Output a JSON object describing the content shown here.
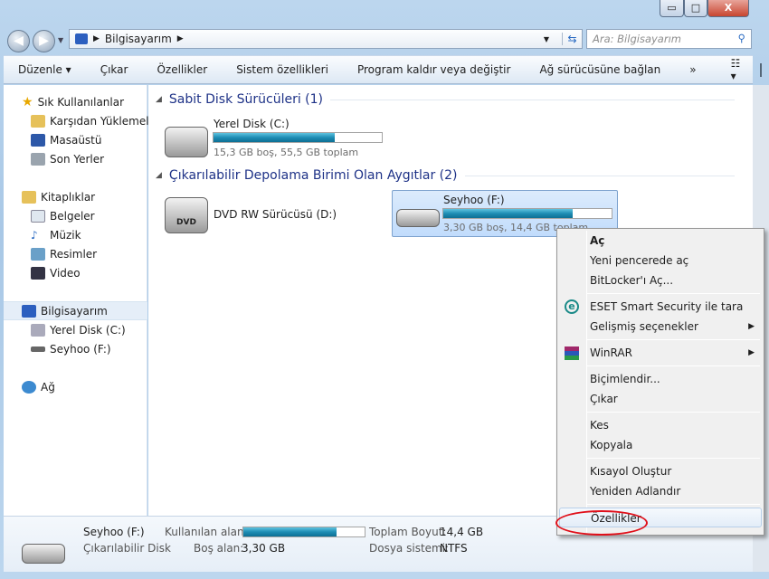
{
  "window": {
    "minimize": "▭",
    "maximize": "□",
    "close": "X"
  },
  "address": {
    "crumb": "Bilgisayarım",
    "search_placeholder": "Ara: Bilgisayarım"
  },
  "toolbar": {
    "items": [
      "Düzenle",
      "Çıkar",
      "Özellikler",
      "Sistem özellikleri",
      "Program kaldır veya değiştir",
      "Ağ sürücüsüne bağlan"
    ],
    "more": "»"
  },
  "sidebar": {
    "favorites": {
      "label": "Sık Kullanılanlar",
      "items": [
        "Karşıdan Yüklemeler",
        "Masaüstü",
        "Son Yerler"
      ]
    },
    "libraries": {
      "label": "Kitaplıklar",
      "items": [
        "Belgeler",
        "Müzik",
        "Resimler",
        "Video"
      ]
    },
    "computer": {
      "label": "Bilgisayarım",
      "items": [
        "Yerel Disk (C:)",
        "Seyhoo (F:)"
      ]
    },
    "network": {
      "label": "Ağ"
    }
  },
  "groups": [
    {
      "title": "Sabit Disk Sürücüleri (1)"
    },
    {
      "title": "Çıkarılabilir Depolama Birimi Olan Aygıtlar (2)"
    }
  ],
  "drives": {
    "c": {
      "name": "Yerel Disk (C:)",
      "info": "15,3 GB boş, 55,5 GB toplam",
      "used_fraction": 0.72
    },
    "d": {
      "name": "DVD RW Sürücüsü (D:)",
      "badge": "DVD"
    },
    "f": {
      "name": "Seyhoo (F:)",
      "info": "3,30 GB boş, 14,4 GB toplam",
      "used_fraction": 0.77
    }
  },
  "details": {
    "name": "Seyhoo (F:)",
    "type": "Çıkarılabilir Disk",
    "used_label": "Kullanılan alan:",
    "free_label": "Boş alan:",
    "free": "3,30 GB",
    "total_label": "Toplam Boyut:",
    "total": "14,4 GB",
    "fs_label": "Dosya sistemi:",
    "fs": "NTFS",
    "used_fraction": 0.77
  },
  "menu": {
    "items": [
      "Aç",
      "Yeni pencerede aç",
      "BitLocker'ı Aç...",
      "ESET Smart Security ile tara",
      "Gelişmiş seçenekler",
      "WinRAR",
      "Biçimlendir...",
      "Çıkar",
      "Kes",
      "Kopyala",
      "Kısayol Oluştur",
      "Yeniden Adlandır",
      "Özellikler"
    ],
    "eset_glyph": "e"
  },
  "colors": {
    "accent": "#1e8db4",
    "highlight_circle": "#e0101a"
  }
}
